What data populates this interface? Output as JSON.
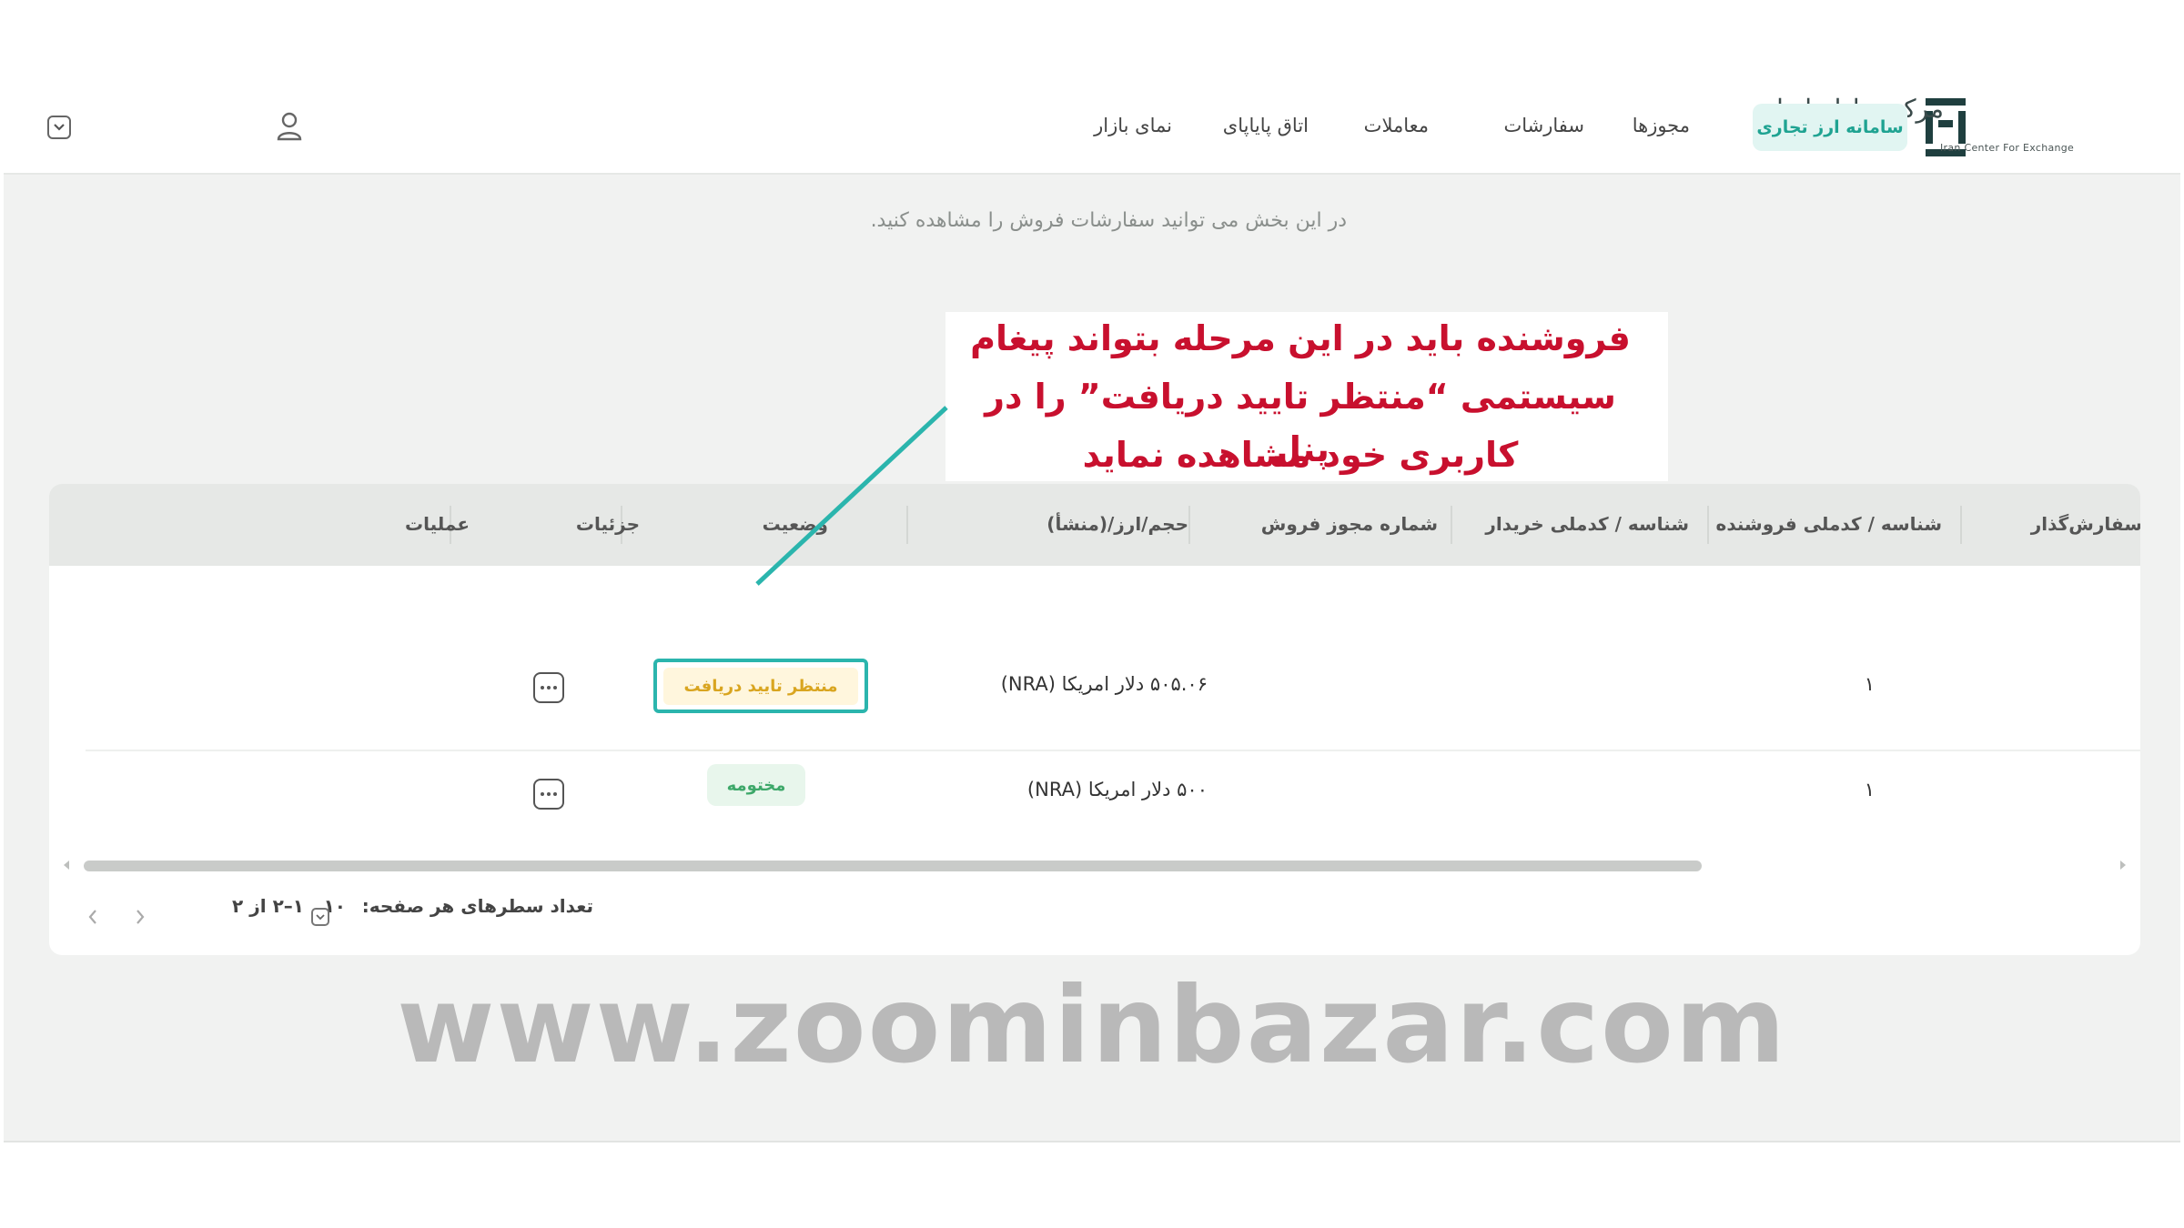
{
  "header": {
    "logo_fa": "مرکز مبادله ایران",
    "logo_en": "Iran Center For Exchange",
    "badge": "سامانه ارز تجاری",
    "nav": [
      "مجوزها",
      "سفارشات",
      "معاملات",
      "اتاق پایاپای",
      "نمای بازار"
    ]
  },
  "page": {
    "subtitle": "در این بخش می توانید سفارشات فروش را مشاهده کنید."
  },
  "callout": {
    "lines": [
      "فروشنده باید در این مرحله بتواند پیغام",
      "سیستمی “منتظر تایید دریافت” را در پنل",
      "کاربری خود مشاهده نماید"
    ],
    "color": "#c8102e"
  },
  "table": {
    "columns": [
      "سفارش‌گذار",
      "شناسه / کدملی فروشنده",
      "شناسه / کدملی خریدار",
      "شماره مجوز فروش",
      "حجم/ارز/(منشأ)",
      "وضعیت",
      "جزئیات",
      "عملیات"
    ],
    "rows": [
      {
        "seller_id": "۱",
        "amount": "۵۰۵.۰۶ دلار امریکا (NRA)",
        "status": "منتظر تایید دریافت"
      },
      {
        "seller_id": "۱",
        "amount": "۵۰۰ دلار امریکا (NRA)",
        "status": "مختومه"
      }
    ]
  },
  "pagination": {
    "rows_per_page_label": "تعداد سطرهای هر صفحه:",
    "rows_per_page_value": "۱۰",
    "range": "۱–۲ از ۲"
  },
  "watermark": "www.zoominbazar.com",
  "colors": {
    "accent": "#2bb5ad",
    "pending_bg": "#fff6dd",
    "pending_text": "#d9a520",
    "closed_bg": "#e8f6ec",
    "closed_text": "#3ea86a"
  }
}
